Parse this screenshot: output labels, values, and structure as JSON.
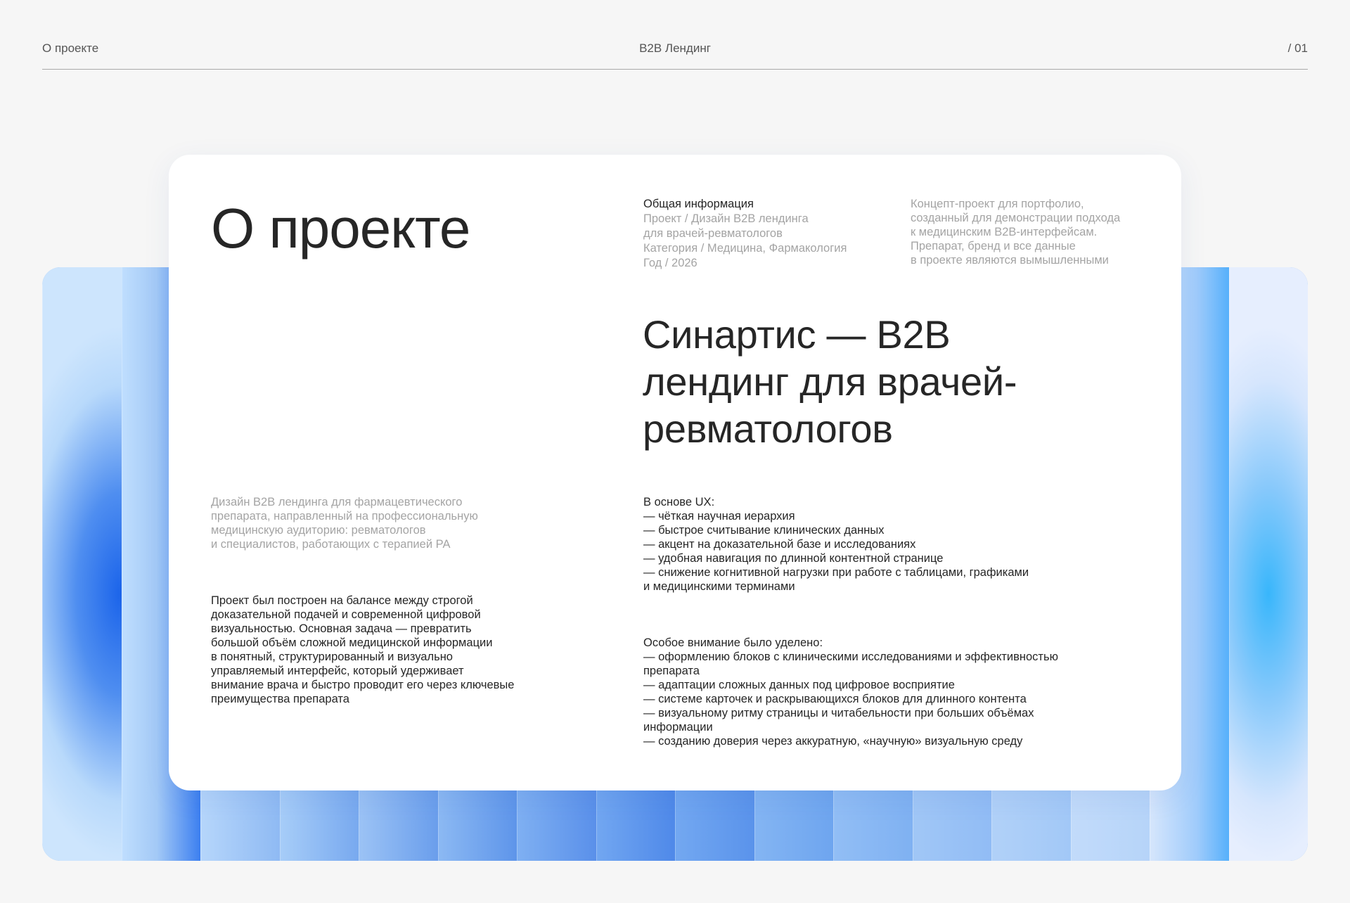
{
  "header": {
    "left": "О проекте",
    "center": "B2B Лендинг",
    "right": "/ 01"
  },
  "card": {
    "title": "О проекте",
    "info": {
      "heading": "Общая информация",
      "lines": [
        "Проект / Дизайн B2B лендинга\nдля врачей-ревматологов",
        "Категория / Медицина, Фармакология",
        "Год / 2026"
      ]
    },
    "disclaimer": "Концепт-проект для портфолио,\nсозданный для демонстрации подхода\nк медицинским B2B-интерфейсам.\nПрепарат, бренд и все данные\nв проекте являются вымышленными",
    "headline": "Синартис — B2B лендинг для врачей-ревматологов",
    "description": "Дизайн B2B лендинга для фармацевтического\nпрепарата, направленный на профессиональную\nмедицинскую аудиторию: ревматологов\nи специалистов, работающих с терапией РА",
    "approach": "Проект был построен на балансе между строгой\nдоказательной подачей и современной цифровой\nвизуальностью. Основная задача — превратить\nбольшой объём сложной медицинской информации\nв понятный, структурированный и визуально\nуправляемый интерфейс, который удерживает\nвнимание врача и быстро проводит его через ключевые\nпреимущества препарата",
    "ux": "В основе UX:\n — чёткая научная иерархия\n — быстрое считывание клинических данных\n — акцент на доказательной базе и исследованиях\n — удобная навигация по длинной контентной странице\n — снижение когнитивной нагрузки при работе с таблицами, графиками\nи медицинскими терминами",
    "focus": "Особое внимание было уделено:\n — оформлению блоков с клиническими исследованиями и эффективностью\nпрепарата\n — адаптации сложных данных под цифровое восприятие\n — системе карточек и раскрывающихся блоков для длинного контента\n — визуальному ритму страницы и читабельности при больших объёмах\nинформации\n — созданию доверия через аккуратную, «научную» визуальную среду"
  },
  "colors": {
    "page_background": "#f6f6f6",
    "card_background": "#ffffff",
    "text_dark": "#262626",
    "text_muted": "#a4a4a4",
    "divider": "#a9a9a9",
    "gradient_blue_deep": "#1a63ea",
    "gradient_blue_light": "#bcdcfd",
    "gradient_cyan": "#38b6fb"
  }
}
